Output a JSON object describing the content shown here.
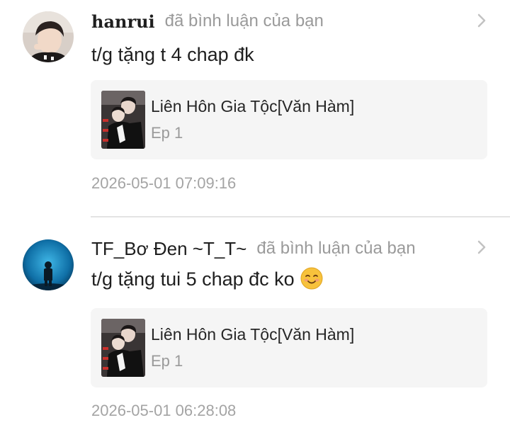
{
  "notifications": [
    {
      "username": "hanrui",
      "action": "đã bình luận của bạn",
      "comment": "t/g tặng t 4 chap đk",
      "has_emoji": false,
      "card": {
        "title": "Liên Hôn Gia Tộc[Văn Hàm]",
        "episode": "Ep 1"
      },
      "timestamp": "2026-05-01 07:09:16"
    },
    {
      "username": "TF_Bơ Đen ~T_T~",
      "action": "đã bình luận của bạn",
      "comment": "t/g tặng tui 5 chap đc ko",
      "has_emoji": true,
      "emoji_icon": "smiling-face-icon",
      "card": {
        "title": "Liên Hôn Gia Tộc[Văn Hàm]",
        "episode": "Ep 1"
      },
      "timestamp": "2026-05-01 06:28:08"
    }
  ]
}
